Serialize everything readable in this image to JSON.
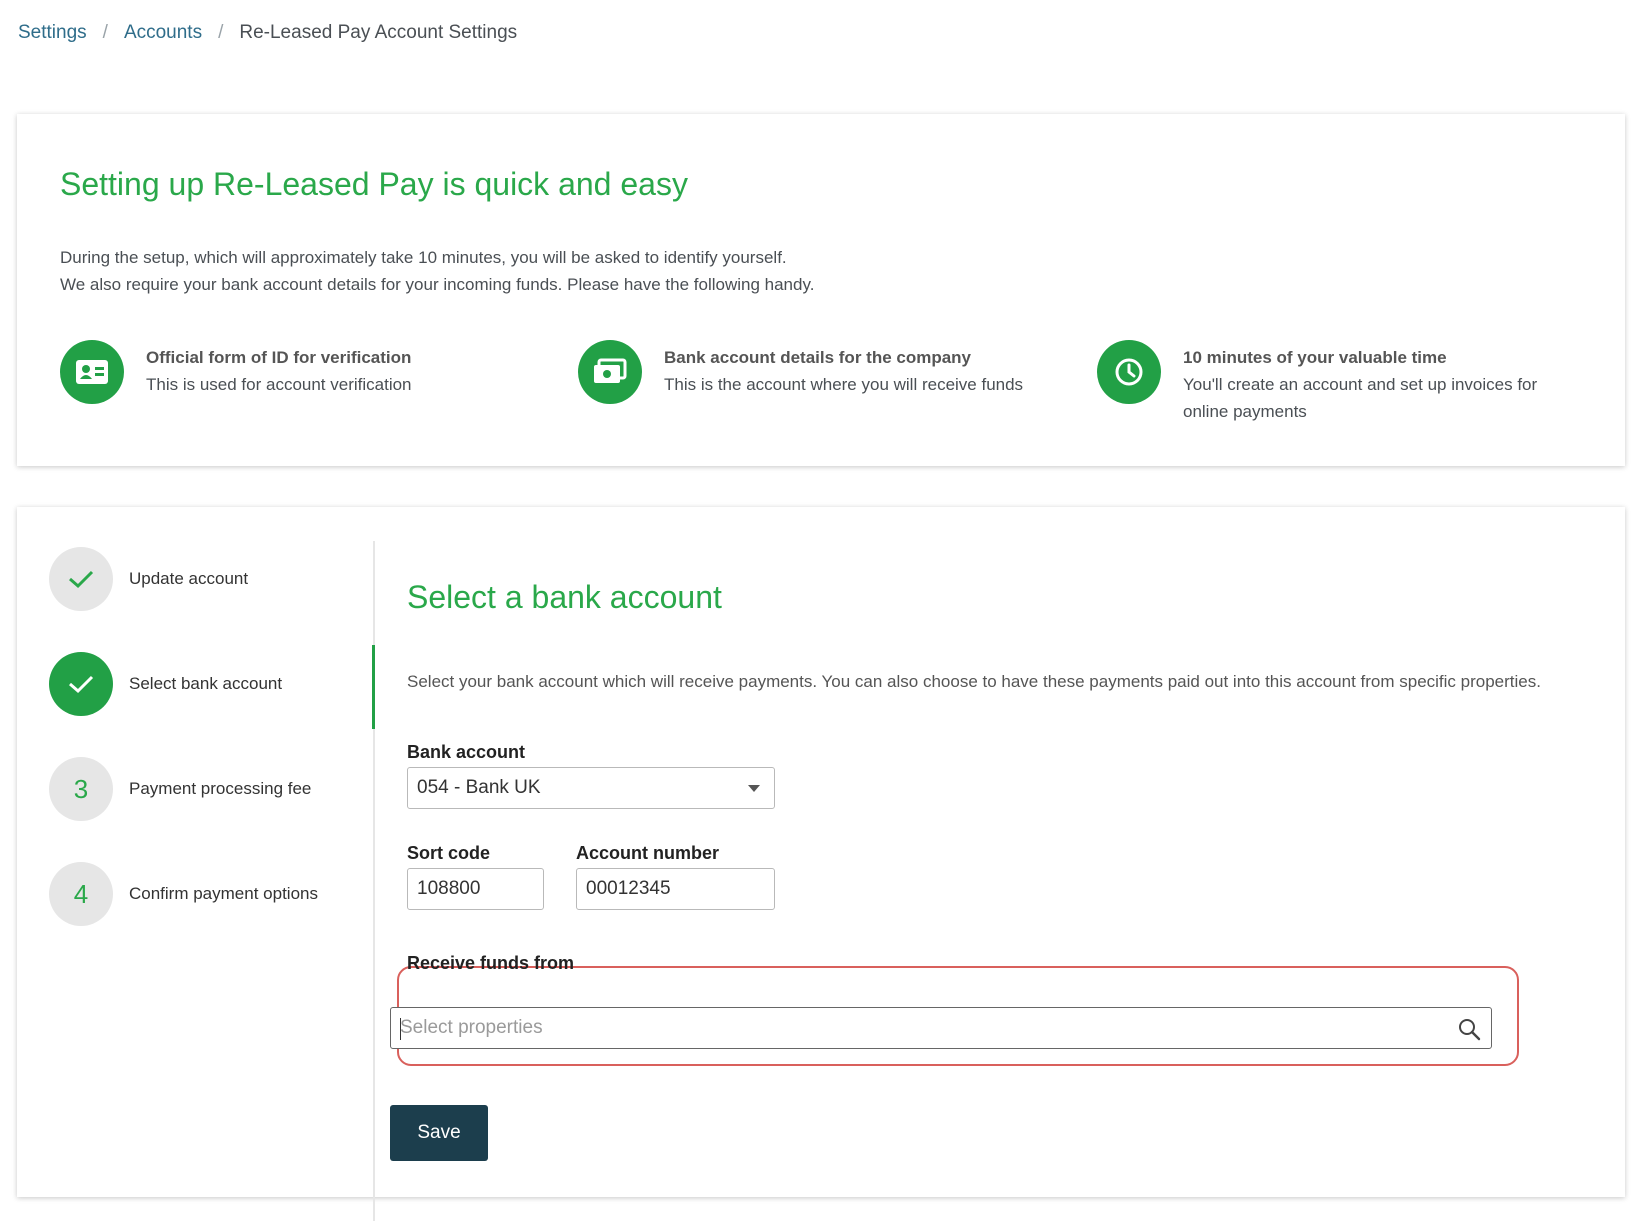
{
  "breadcrumb": {
    "settings": "Settings",
    "accounts": "Accounts",
    "current": "Re-Leased Pay Account Settings",
    "separator": "/"
  },
  "intro": {
    "title": "Setting up Re-Leased Pay is quick and easy",
    "line1": "During the setup, which will approximately take 10 minutes, you will be asked to identify yourself.",
    "line2": "We also require your bank account details for your incoming funds. Please have the following handy.",
    "requirements": [
      {
        "icon": "id-card-icon",
        "title": "Official form of ID for verification",
        "desc": "This is used for account verification"
      },
      {
        "icon": "money-icon",
        "title": "Bank account details for the company",
        "desc": "This is the account where you will receive funds"
      },
      {
        "icon": "clock-icon",
        "title": "10 minutes of your valuable time",
        "desc": "You'll create an account and set up invoices for online payments"
      }
    ]
  },
  "steps": [
    {
      "number": "1",
      "label": "Update account",
      "state": "completed"
    },
    {
      "number": "2",
      "label": "Select bank account",
      "state": "active"
    },
    {
      "number": "3",
      "label": "Payment processing fee",
      "state": "pending"
    },
    {
      "number": "4",
      "label": "Confirm payment options",
      "state": "pending"
    }
  ],
  "form": {
    "title": "Select a bank account",
    "description": "Select your bank account which will receive payments. You can also choose to have these payments paid out into this account from specific properties.",
    "bank_account_label": "Bank account",
    "bank_account_value": "054 - Bank UK",
    "sort_code_label": "Sort code",
    "sort_code_value": "108800",
    "account_number_label": "Account number",
    "account_number_value": "00012345",
    "receive_funds_label": "Receive funds from",
    "receive_funds_placeholder": "Select properties",
    "save_label": "Save"
  },
  "colors": {
    "accent_green": "#22a046",
    "primary_button": "#1c3e4d",
    "highlight_border": "#d9605c"
  }
}
